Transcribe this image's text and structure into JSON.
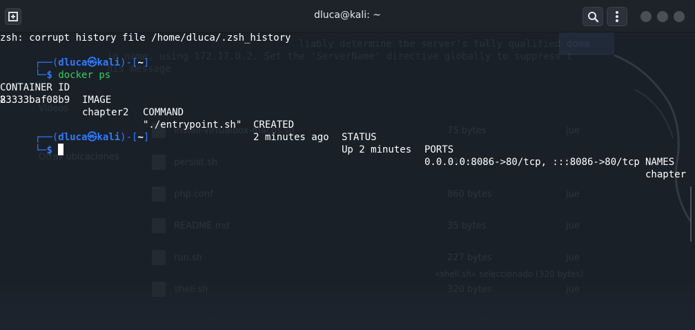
{
  "window": {
    "title": "dluca@kali: ~"
  },
  "titlebar": {
    "new_tab_icon": "new-tab-icon",
    "search_icon": "search-icon",
    "menu_icon": "kebab-menu-icon"
  },
  "terminal": {
    "warning": "zsh: corrupt history file /home/dluca/.zsh_history",
    "prompt1": {
      "corner": "┌──(",
      "user_host": "dluca㉿kali",
      "close": ")-[",
      "path": "~",
      "end": "]"
    },
    "prompt1_line2": {
      "corner": "└─",
      "dollar": "$",
      "command": "docker ps"
    },
    "table": {
      "headers": [
        "CONTAINER ID",
        "IMAGE",
        "COMMAND",
        "CREATED",
        "STATUS",
        "PORTS",
        "NAMES"
      ],
      "row": [
        "83333baf08b9",
        "chapter2",
        "\"./entrypoint.sh\"",
        "2 minutes ago",
        "Up 2 minutes",
        "0.0.0.0:8086->80/tcp, :::8086->80/tcp",
        "chapter"
      ],
      "wrap": "2"
    },
    "prompt2": {
      "corner": "┌──(",
      "user_host": "dluca㉿kali",
      "close": ")-[",
      "path": "~",
      "end": "]"
    },
    "prompt2_line2": {
      "corner": "└─",
      "dollar": "$"
    }
  },
  "background": {
    "ghost_lines": [
      "liably determine the server's fully qualified doma",
      "in name, using 172.17.0.2. Set the 'ServerName' directive globally to suppress t",
      "his message"
    ],
    "files": [
      {
        "name": "install-virtualbox-macos.sh",
        "size": "75 bytes",
        "date": "jue"
      },
      {
        "name": "persist.sh",
        "size": "330 bytes",
        "date": "jue"
      },
      {
        "name": "php.conf",
        "size": "860 bytes",
        "date": "jue"
      },
      {
        "name": "README.md",
        "size": "35 bytes",
        "date": "jue"
      },
      {
        "name": "run.sh",
        "size": "227 bytes",
        "date": "jue"
      },
      {
        "name": "shell.sh",
        "size": "320 bytes",
        "date": "jue"
      }
    ],
    "sidebar": [
      "Videos",
      "Otras ubicaciones"
    ],
    "status": "«shell.sh» seleccionado (320 bytes)"
  }
}
